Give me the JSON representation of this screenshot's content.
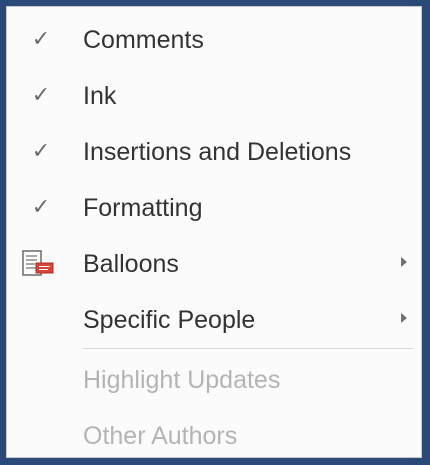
{
  "menu": {
    "items": [
      {
        "label": "Comments",
        "checked": true,
        "enabled": true
      },
      {
        "label": "Ink",
        "checked": true,
        "enabled": true
      },
      {
        "label": "Insertions and Deletions",
        "checked": true,
        "enabled": true
      },
      {
        "label": "Formatting",
        "checked": true,
        "enabled": true
      },
      {
        "label": "Balloons",
        "checked": false,
        "enabled": true,
        "icon": "balloons-icon",
        "submenu": true
      },
      {
        "label": "Specific People",
        "checked": false,
        "enabled": true,
        "submenu": true
      },
      {
        "label": "Highlight Updates",
        "checked": false,
        "enabled": false
      },
      {
        "label": "Other Authors",
        "checked": false,
        "enabled": false
      }
    ]
  },
  "colors": {
    "check": "#6b6b6b",
    "text": "#333333",
    "disabled_text": "#b4b4b4",
    "icon_red": "#d9443a",
    "frame": "#2b4a7a"
  }
}
